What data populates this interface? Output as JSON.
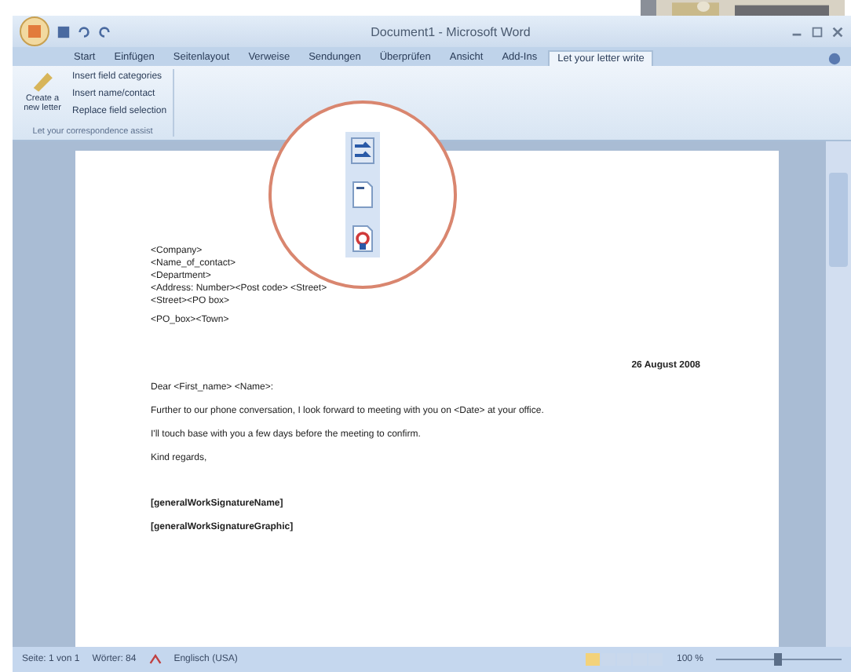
{
  "window": {
    "title": "Document1 - Microsoft Word"
  },
  "tabs": [
    {
      "label": "Start",
      "selected": false
    },
    {
      "label": "Einfügen",
      "selected": false
    },
    {
      "label": "Seitenlayout",
      "selected": false
    },
    {
      "label": "Verweise",
      "selected": false
    },
    {
      "label": "Sendungen",
      "selected": false
    },
    {
      "label": "Überprüfen",
      "selected": false
    },
    {
      "label": "Ansicht",
      "selected": false
    },
    {
      "label": "Add-Ins",
      "selected": false
    },
    {
      "label": "Let your letter write",
      "selected": true
    }
  ],
  "ribbon": {
    "big_button": "Create a new letter",
    "commands": [
      "Insert field categories",
      "Insert name/contact",
      "Replace field selection"
    ],
    "group_label": "Let your correspondence assist"
  },
  "document": {
    "address_lines": [
      "<Company>",
      "<Name_of_contact>",
      "<Department>",
      "<Address: Number><Post code> <Street>",
      "<Street><PO box>"
    ],
    "po_line": "<PO_box><Town>",
    "date": "26 August 2008",
    "salutation": "Dear <First_name> <Name>:",
    "body": [
      "Further to our phone conversation, I look forward to meeting with you on <Date> at your office.",
      "I'll touch base with you a few days before the meeting to confirm.",
      "Kind regards,"
    ],
    "signature": [
      "[generalWorkSignatureName]",
      "[generalWorkSignatureGraphic]"
    ]
  },
  "status_bar": [
    "Seite: 1 von 1",
    "Wörter: 84",
    "Englisch (USA)",
    "100 %"
  ]
}
